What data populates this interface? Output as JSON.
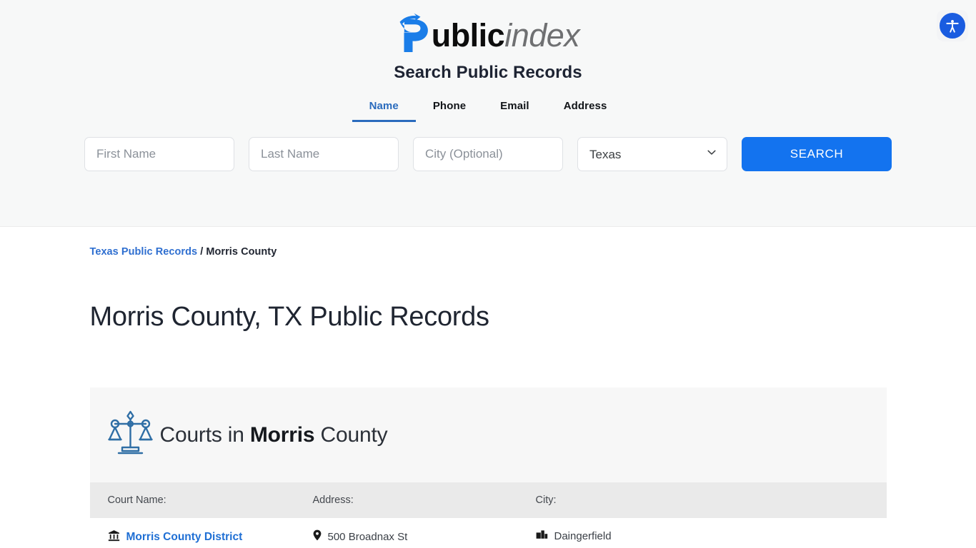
{
  "header": {
    "logo": {
      "mark": "p-arrow-logo-icon",
      "text_bold": "ublic",
      "text_italic": "index",
      "color": "#1a7de8"
    },
    "accessibility": {
      "icon": "accessibility-person-icon",
      "label": "Accessibility",
      "color": "#1a5ce0"
    },
    "search_title": "Search Public Records",
    "tabs": [
      {
        "label": "Name",
        "active": true
      },
      {
        "label": "Phone",
        "active": false
      },
      {
        "label": "Email",
        "active": false
      },
      {
        "label": "Address",
        "active": false
      }
    ],
    "form": {
      "first_name_placeholder": "First Name",
      "first_name_value": "",
      "last_name_placeholder": "Last Name",
      "last_name_value": "",
      "city_placeholder": "City (Optional)",
      "city_value": "",
      "state_selected": "Texas",
      "state_options": [
        "Texas"
      ],
      "state_chevron_icon": "chevron-down-icon",
      "search_button_label": "SEARCH",
      "search_button_color": "#1373ef"
    }
  },
  "breadcrumb": {
    "link_label": "Texas Public Records",
    "separator": "/",
    "current": "Morris County"
  },
  "page_title": "Morris County, TX Public Records",
  "courts_card": {
    "icon": "scales-of-justice-icon",
    "icon_color": "#2f6ea5",
    "title_prefix": "Courts in ",
    "title_bold": "Morris",
    "title_suffix": " County",
    "columns": [
      "Court Name:",
      "Address:",
      "City:"
    ],
    "rows": [
      {
        "name_icon": "courthouse-bank-icon",
        "name": "Morris County District",
        "address_icon": "map-pin-icon",
        "address": "500 Broadnax St",
        "city_icon": "city-buildings-icon",
        "city": "Daingerfield"
      }
    ]
  }
}
